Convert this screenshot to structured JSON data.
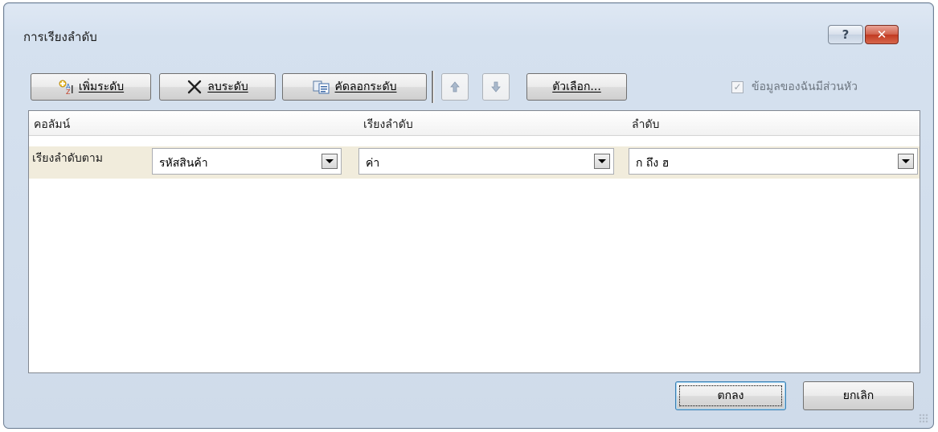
{
  "dialog": {
    "title": "การเรียงลำดับ",
    "help_glyph": "?",
    "close_glyph": "✕"
  },
  "toolbar": {
    "add_level": "เพิ่มระดับ",
    "delete_level": "ลบระดับ",
    "copy_level": "คัดลอกระดับ",
    "options": "ตัวเลือก...",
    "my_data_has_headers": "ข้อมูลของฉันมีส่วนหัว",
    "headers_checked": true
  },
  "grid": {
    "columns": [
      "คอลัมน์",
      "เรียงลำดับ",
      "ลำดับ"
    ],
    "rows": [
      {
        "label": "เรียงลำดับตาม",
        "column_value": "รหัสสินค้า",
        "sort_on_value": "ค่า",
        "order_value": "ก ถึง ฮ"
      }
    ]
  },
  "buttons": {
    "ok": "ตกลง",
    "cancel": "ยกเลิก"
  },
  "colors": {
    "dialog_bg": "#d5e1ef",
    "row_highlight": "#f1ecdc",
    "close_red": "#c23a22"
  }
}
